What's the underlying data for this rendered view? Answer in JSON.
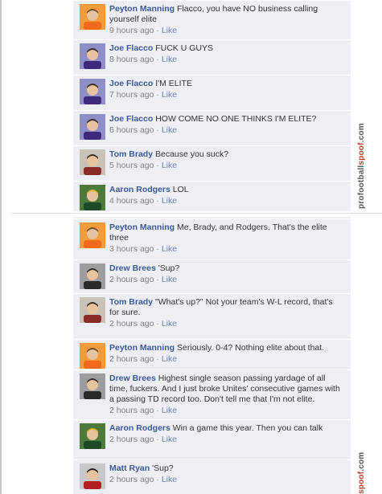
{
  "comments_top": [
    {
      "name": "Peyton Manning",
      "text": "Flacco, you have NO business calling yourself elite",
      "time": "9 hours ago",
      "like": "Like",
      "avatar": "broncos-qb"
    },
    {
      "name": "Joe Flacco",
      "text": "FUCK U GUYS",
      "time": "8 hours ago",
      "like": "Like",
      "avatar": "ravens-qb"
    },
    {
      "name": "Joe Flacco",
      "text": "I'M ELITE",
      "time": "7 hours ago",
      "like": "Like",
      "avatar": "ravens-qb"
    },
    {
      "name": "Joe Flacco",
      "text": "HOW COME NO ONE THINKS I'M ELITE?",
      "time": "6 hours ago",
      "like": "Like",
      "avatar": "ravens-qb"
    },
    {
      "name": "Tom Brady",
      "text": "Because you suck?",
      "time": "5 hours ago",
      "like": "Like",
      "avatar": "patriots-qb"
    },
    {
      "name": "Aaron Rodgers",
      "text": "LOL",
      "time": "4 hours ago",
      "like": "Like",
      "avatar": "packers-qb"
    }
  ],
  "comments_bottom": [
    {
      "name": "Peyton Manning",
      "text": "Me, Brady, and Rodgers. That's the elite three",
      "time": "3 hours ago",
      "like": "Like",
      "avatar": "broncos-qb"
    },
    {
      "name": "Drew Brees",
      "text": "'Sup?",
      "time": "2 hours ago",
      "like": "Like",
      "avatar": "saints-qb"
    },
    {
      "name": "Tom Brady",
      "text": "\"What's up?\" Not your team's W-L record, that's for sure.",
      "time": "2 hours ago",
      "like": "Like",
      "avatar": "patriots-qb"
    },
    {
      "name": "Peyton Manning",
      "text": "Seriously. 0-4? Nothing elite about that.",
      "time": "2 hours ago",
      "like": "Like",
      "avatar": "broncos-qb"
    },
    {
      "name": "Drew Brees",
      "text": "Highest single season passing yardage of all time, fuckers. And I just broke Unites' consecutive games with a passing TD record too. Don't tell me that I'm not elite.",
      "time": "2 hours ago",
      "like": "Like",
      "avatar": "saints-qb"
    },
    {
      "name": "Aaron Rodgers",
      "text": "Win a game this year. Then you can talk",
      "time": "2 hours ago",
      "like": "Like",
      "avatar": "packers-qb"
    },
    {
      "name": "Matt Ryan",
      "text": "'Sup?",
      "time": "2 hours ago",
      "like": "Like",
      "avatar": "falcons-qb"
    }
  ],
  "meta_separator": "·",
  "watermark_top": {
    "part1": "profootball",
    "part2": "spoof",
    "part3": ".com"
  },
  "watermark_bottom": {
    "part1": "spoof",
    "part2": ".com"
  },
  "colors": {
    "name": "#3b5998",
    "like": "#6d84b4",
    "panel": "#edeff4",
    "meta": "#808080"
  }
}
